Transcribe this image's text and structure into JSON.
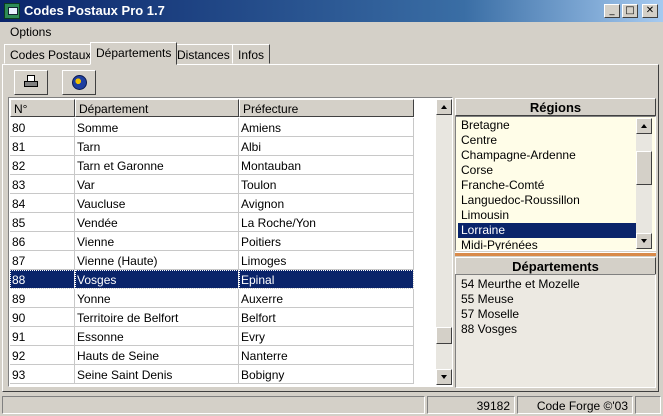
{
  "window": {
    "title": "Codes Postaux Pro 1.7",
    "minimize_glyph": "_",
    "maximize_glyph": "□",
    "close_glyph": "✕"
  },
  "menu": {
    "options_label": "Options"
  },
  "tabs": [
    {
      "label": "Codes Postaux",
      "active": false
    },
    {
      "label": "Départements",
      "active": true
    },
    {
      "label": "Distances",
      "active": false
    },
    {
      "label": "Infos",
      "active": false
    }
  ],
  "toolbar": {
    "print_icon": "printer-icon",
    "web_icon": "globe-icon"
  },
  "table": {
    "columns": [
      "N°",
      "Département",
      "Préfecture"
    ],
    "rows": [
      {
        "num": "80",
        "dept": "Somme",
        "pref": "Amiens"
      },
      {
        "num": "81",
        "dept": "Tarn",
        "pref": "Albi"
      },
      {
        "num": "82",
        "dept": "Tarn et Garonne",
        "pref": "Montauban"
      },
      {
        "num": "83",
        "dept": "Var",
        "pref": "Toulon"
      },
      {
        "num": "84",
        "dept": "Vaucluse",
        "pref": "Avignon"
      },
      {
        "num": "85",
        "dept": "Vendée",
        "pref": "La Roche/Yon"
      },
      {
        "num": "86",
        "dept": "Vienne",
        "pref": "Poitiers"
      },
      {
        "num": "87",
        "dept": "Vienne (Haute)",
        "pref": "Limoges"
      },
      {
        "num": "88",
        "dept": "Vosges",
        "pref": "Epinal"
      },
      {
        "num": "89",
        "dept": "Yonne",
        "pref": "Auxerre"
      },
      {
        "num": "90",
        "dept": "Territoire de Belfort",
        "pref": "Belfort"
      },
      {
        "num": "91",
        "dept": "Essonne",
        "pref": "Evry"
      },
      {
        "num": "92",
        "dept": "Hauts de Seine",
        "pref": "Nanterre"
      },
      {
        "num": "93",
        "dept": "Seine Saint Denis",
        "pref": "Bobigny"
      }
    ],
    "selected_index": 8
  },
  "regions": {
    "header": "Régions",
    "items": [
      "Bretagne",
      "Centre",
      "Champagne-Ardenne",
      "Corse",
      "Franche-Comté",
      "Languedoc-Roussillon",
      "Limousin",
      "Lorraine",
      "Midi-Pyrénées"
    ],
    "selected": "Lorraine"
  },
  "departements": {
    "header": "Départements",
    "items": [
      "54 Meurthe et Mozelle",
      "55 Meuse",
      "57 Moselle",
      "88 Vosges"
    ]
  },
  "status": {
    "count": "39182",
    "credit": "Code Forge ©'03"
  },
  "colors": {
    "selection": "#0a246a",
    "region_bg": "#fffde8",
    "divider": "#d98a4a",
    "title_gradient_start": "#0a246a"
  }
}
